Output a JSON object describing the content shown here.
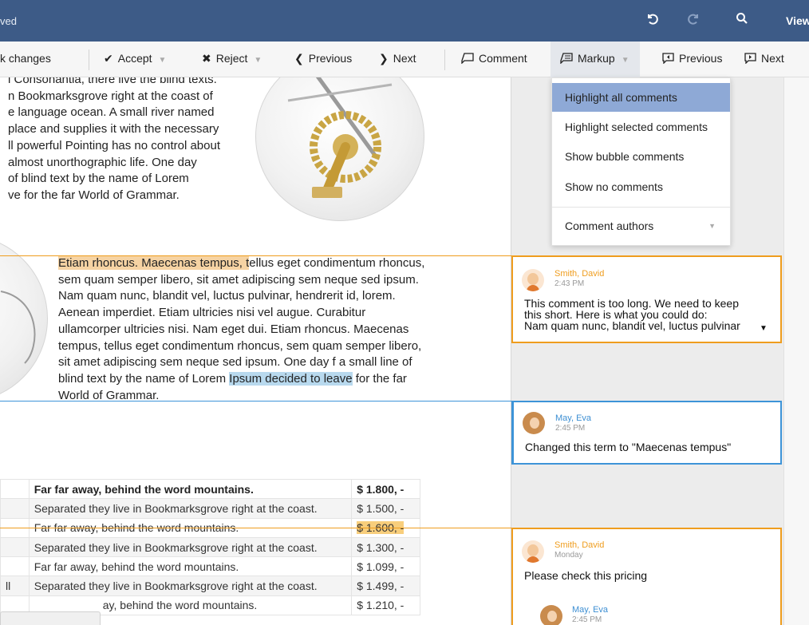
{
  "titlebar": {
    "doc_status": "ved",
    "view_label": "View"
  },
  "toolbar": {
    "track_changes": "k changes",
    "accept": "Accept",
    "reject": "Reject",
    "previous": "Previous",
    "next": "Next",
    "comment": "Comment",
    "markup": "Markup",
    "comment_previous": "Previous",
    "comment_next": "Next"
  },
  "markup_menu": {
    "items": [
      "Highlight all comments",
      "Highlight selected comments",
      "Show bubble comments",
      "Show no comments"
    ],
    "authors": "Comment authors"
  },
  "document": {
    "para1_lines": [
      "i Consonantia, there live the blind texts.",
      "n Bookmarksgrove right at the coast of",
      "e language ocean. A small river named",
      "place and supplies it with the necessary",
      "ll powerful Pointing has no control about",
      " almost unorthographic life. One day",
      "of blind text by the name of Lorem",
      "ve for the far World of Grammar."
    ],
    "para2": {
      "highlight_orange": "Etiam rhoncus. Maecenas tempus, t",
      "after_orange": "ellus eget condimentum rhoncus, sem quam semper libero, sit amet adipiscing sem neque sed ipsum. Nam quam nunc, blandit vel, luctus pulvinar, hendrerit id, lorem. Aenean imperdiet. Etiam ultricies nisi vel augue. Curabitur ullamcorper ultricies nisi. Nam eget dui. Etiam rhoncus. Maecenas tempus, tellus eget condimentum rhoncus, sem quam semper libero, sit amet adipiscing sem neque sed ipsum. One day f a small line of blind text by the name of Lorem ",
      "highlight_blue": "Ipsum decided to leave",
      "tail": " for the far World of Grammar."
    },
    "table": [
      {
        "c0": "",
        "c1": "Far far away, behind the word mountains.",
        "c2": "$ 1.800, -"
      },
      {
        "c0": "",
        "c1": "Separated they live in Bookmarksgrove right at the coast.",
        "c2": "$ 1.500, -"
      },
      {
        "c0": "",
        "c1": "Far far away, behind the word mountains.",
        "c2": "$ 1.600, -"
      },
      {
        "c0": "",
        "c1": "Separated they live in Bookmarksgrove right at the coast.",
        "c2": "$ 1.300, -"
      },
      {
        "c0": "",
        "c1": "Far far away, behind the word mountains.",
        "c2": "$ 1.099, -"
      },
      {
        "c0": "ll",
        "c1": "Separated they live in Bookmarksgrove right at the coast.",
        "c2": "$ 1.499, -"
      },
      {
        "c0": "",
        "c1": "ay, behind the word mountains.",
        "c2": "$ 1.210, -"
      }
    ]
  },
  "comments": [
    {
      "author": "Smith, David",
      "time": "2:43 PM",
      "text_lines": [
        "This comment is too long. We need to keep",
        "this short. Here is what you could do:",
        "Nam quam nunc, blandit vel, luctus pulvinar"
      ]
    },
    {
      "author": "May, Eva",
      "time": "2:45 PM",
      "text_lines": [
        "Changed this term to \"Maecenas tempus\""
      ]
    },
    {
      "author": "Smith, David",
      "time": "Monday",
      "text_lines": [
        "Please check this pricing"
      ],
      "reply": {
        "author": "May, Eva",
        "time": "2:45 PM"
      }
    }
  ],
  "colors": {
    "titlebar": "#3d5b87",
    "comment_orange": "#ef9d1e",
    "comment_blue": "#3d94d8",
    "menu_active": "#8ea9d6"
  },
  "icons": {
    "undo": "undo-icon",
    "redo": "redo-icon",
    "search": "search-icon",
    "accept": "check-icon",
    "reject": "x-icon",
    "previous": "chevron-left-icon",
    "next": "chevron-right-icon",
    "comment": "comment-icon",
    "markup": "markup-icon"
  }
}
